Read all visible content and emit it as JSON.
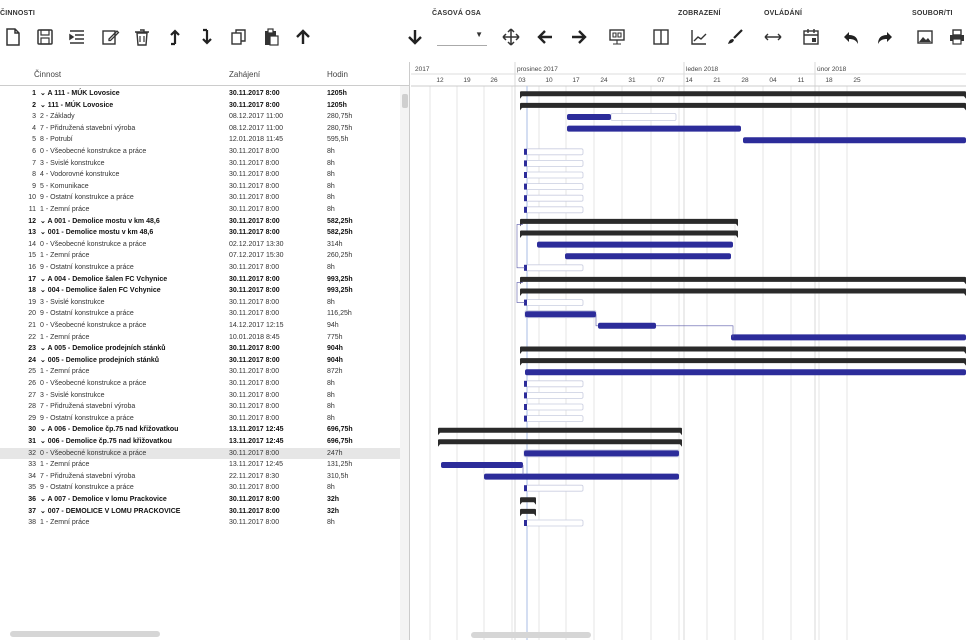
{
  "toolbar": {
    "groups": {
      "cinnosti": "ČINNOSTI",
      "casova_osa": "ČASOVÁ OSA",
      "zobrazeni": "ZOBRAZENÍ",
      "ovladani": "OVLÁDÁNÍ",
      "soubor": "SOUBOR/TI"
    },
    "icons": [
      "new-icon",
      "save-icon",
      "indent-icon",
      "edit-icon",
      "delete-icon",
      "move-up-icon",
      "move-down-icon",
      "copy-icon",
      "paste-icon",
      "arrow-up-icon",
      "arrow-down-icon",
      "move-icon",
      "arrow-left-icon",
      "arrow-right-icon",
      "screen-icon",
      "columns-icon",
      "chart-icon",
      "brush-icon",
      "resize-icon",
      "calendar-icon",
      "undo-icon",
      "redo-icon",
      "image-icon",
      "print-icon"
    ]
  },
  "grid": {
    "headers": {
      "name": "Činnost",
      "start": "Zahájení",
      "hours": "Hodin"
    },
    "rows": [
      {
        "n": "1",
        "name": "⌄ A 111 - MÚK Lovosice",
        "start": "30.11.2017 8:00",
        "hours": "1205h",
        "bold": true
      },
      {
        "n": "2",
        "name": "   ⌄ 111 - MÚK Lovosice",
        "start": "30.11.2017 8:00",
        "hours": "1205h",
        "bold": true
      },
      {
        "n": "3",
        "name": "        2 - Základy",
        "start": "08.12.2017 11:00",
        "hours": "280,75h"
      },
      {
        "n": "4",
        "name": "        7 - Přidružená stavební výroba",
        "start": "08.12.2017 11:00",
        "hours": "280,75h"
      },
      {
        "n": "5",
        "name": "        8 - Potrubí",
        "start": "12.01.2018 11:45",
        "hours": "595,5h"
      },
      {
        "n": "6",
        "name": "        0 - Všeobecné konstrukce a práce",
        "start": "30.11.2017 8:00",
        "hours": "8h"
      },
      {
        "n": "7",
        "name": "        3 - Svislé konstrukce",
        "start": "30.11.2017 8:00",
        "hours": "8h"
      },
      {
        "n": "8",
        "name": "        4 - Vodorovné konstrukce",
        "start": "30.11.2017 8:00",
        "hours": "8h"
      },
      {
        "n": "9",
        "name": "        5 - Komunikace",
        "start": "30.11.2017 8:00",
        "hours": "8h"
      },
      {
        "n": "10",
        "name": "        9 - Ostatní konstrukce a práce",
        "start": "30.11.2017 8:00",
        "hours": "8h"
      },
      {
        "n": "11",
        "name": "        1 - Zemní práce",
        "start": "30.11.2017 8:00",
        "hours": "8h"
      },
      {
        "n": "12",
        "name": "⌄ A 001 - Demolice mostu v km 48,6",
        "start": "30.11.2017 8:00",
        "hours": "582,25h",
        "bold": true
      },
      {
        "n": "13",
        "name": "   ⌄ 001 - Demolice mostu v km 48,6",
        "start": "30.11.2017 8:00",
        "hours": "582,25h",
        "bold": true
      },
      {
        "n": "14",
        "name": "        0 - Všeobecné konstrukce a práce",
        "start": "02.12.2017 13:30",
        "hours": "314h"
      },
      {
        "n": "15",
        "name": "        1 - Zemní práce",
        "start": "07.12.2017 15:30",
        "hours": "260,25h"
      },
      {
        "n": "16",
        "name": "        9 - Ostatní konstrukce a práce",
        "start": "30.11.2017 8:00",
        "hours": "8h"
      },
      {
        "n": "17",
        "name": "⌄ A 004 - Demolice šalen FC Vchynice",
        "start": "30.11.2017 8:00",
        "hours": "993,25h",
        "bold": true
      },
      {
        "n": "18",
        "name": "   ⌄ 004 - Demolice šalen FC Vchynice",
        "start": "30.11.2017 8:00",
        "hours": "993,25h",
        "bold": true
      },
      {
        "n": "19",
        "name": "        3 - Svislé konstrukce",
        "start": "30.11.2017 8:00",
        "hours": "8h"
      },
      {
        "n": "20",
        "name": "        9 - Ostatní konstrukce a práce",
        "start": "30.11.2017 8:00",
        "hours": "116,25h"
      },
      {
        "n": "21",
        "name": "        0 - Všeobecné konstrukce a práce",
        "start": "14.12.2017 12:15",
        "hours": "94h"
      },
      {
        "n": "22",
        "name": "        1 - Zemní práce",
        "start": "10.01.2018 8:45",
        "hours": "775h"
      },
      {
        "n": "23",
        "name": "⌄ A 005 - Demolice prodejních stánků",
        "start": "30.11.2017 8:00",
        "hours": "904h",
        "bold": true
      },
      {
        "n": "24",
        "name": "   ⌄ 005 - Demolice prodejních stánků",
        "start": "30.11.2017 8:00",
        "hours": "904h",
        "bold": true
      },
      {
        "n": "25",
        "name": "        1 - Zemní práce",
        "start": "30.11.2017 8:00",
        "hours": "872h"
      },
      {
        "n": "26",
        "name": "        0 - Všeobecné konstrukce a práce",
        "start": "30.11.2017 8:00",
        "hours": "8h"
      },
      {
        "n": "27",
        "name": "        3 - Svislé konstrukce",
        "start": "30.11.2017 8:00",
        "hours": "8h"
      },
      {
        "n": "28",
        "name": "        7 - Přidružená stavební výroba",
        "start": "30.11.2017 8:00",
        "hours": "8h"
      },
      {
        "n": "29",
        "name": "        9 - Ostatní konstrukce a práce",
        "start": "30.11.2017 8:00",
        "hours": "8h"
      },
      {
        "n": "30",
        "name": "⌄ A 006 - Demolice čp.75 nad křižovatkou",
        "start": "13.11.2017 12:45",
        "hours": "696,75h",
        "bold": true
      },
      {
        "n": "31",
        "name": "   ⌄ 006 - Demolice čp.75 nad křižovatkou",
        "start": "13.11.2017 12:45",
        "hours": "696,75h",
        "bold": true
      },
      {
        "n": "32",
        "name": "        0 - Všeobecné konstrukce a práce",
        "start": "30.11.2017 8:00",
        "hours": "247h",
        "sel": true
      },
      {
        "n": "33",
        "name": "        1 - Zemní práce",
        "start": "13.11.2017 12:45",
        "hours": "131,25h"
      },
      {
        "n": "34",
        "name": "        7 - Přidružená stavební výroba",
        "start": "22.11.2017 8:30",
        "hours": "310,5h"
      },
      {
        "n": "35",
        "name": "        9 - Ostatní konstrukce a práce",
        "start": "30.11.2017 8:00",
        "hours": "8h"
      },
      {
        "n": "36",
        "name": "⌄ A 007 - Demolice v lomu Prackovice",
        "start": "30.11.2017 8:00",
        "hours": "32h",
        "bold": true
      },
      {
        "n": "37",
        "name": "   ⌄ 007 - DEMOLICE V LOMU PRACKOVICE",
        "start": "30.11.2017 8:00",
        "hours": "32h",
        "bold": true
      },
      {
        "n": "38",
        "name": "        1 - Zemní práce",
        "start": "30.11.2017 8:00",
        "hours": "8h"
      }
    ]
  },
  "timeline": {
    "months": [
      {
        "label": "2017"
      },
      {
        "label": "prosinec 2017"
      },
      {
        "label": "leden 2018"
      },
      {
        "label": "únor 2018"
      }
    ],
    "days": [
      "12",
      "19",
      "26",
      "03",
      "10",
      "17",
      "24",
      "31",
      "07",
      "14",
      "21",
      "28",
      "04",
      "11",
      "18",
      "25"
    ]
  },
  "colors": {
    "bar_task": "#2c2c9a",
    "bar_summary": "#2a2a2a",
    "grid_line": "#e4e4e4",
    "today_line": "#b8c8e8"
  }
}
